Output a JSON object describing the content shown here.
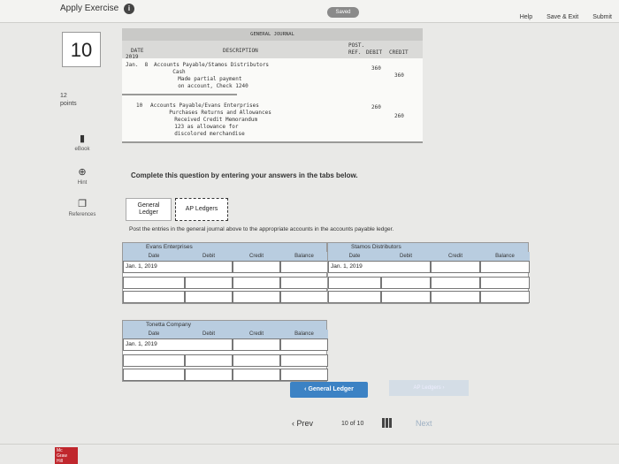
{
  "app": {
    "title": "Apply Exercise",
    "saved": "Saved",
    "help": "Help",
    "save_exit": "Save & Exit",
    "submit": "Submit"
  },
  "question": {
    "number": "10",
    "points_value": "12",
    "points_label": "points"
  },
  "side_tools": [
    {
      "label": "eBook",
      "icon": "book-icon"
    },
    {
      "label": "Hint",
      "icon": "hint-icon"
    },
    {
      "label": "References",
      "icon": "references-icon"
    }
  ],
  "journal": {
    "title": "GENERAL JOURNAL",
    "col_date": "DATE",
    "col_desc": "DESCRIPTION",
    "col_post": "POST.",
    "col_ref": "REF.",
    "col_debit": "DEBIT",
    "col_credit": "CREDIT",
    "year": "2019",
    "lines": [
      {
        "date": "Jan.  8",
        "text": "Accounts Payable/Stamos Distributors",
        "debit": "360",
        "credit": ""
      },
      {
        "date": "",
        "text": "  Cash",
        "debit": "",
        "credit": "360"
      },
      {
        "date": "",
        "text": "  Made partial payment",
        "debit": "",
        "credit": ""
      },
      {
        "date": "",
        "text": "  on account, Check 1240",
        "debit": "",
        "credit": ""
      },
      {
        "date": "10",
        "text": "Accounts Payable/Evans Enterprises",
        "debit": "260",
        "credit": ""
      },
      {
        "date": "",
        "text": "  Purchases Returns and Allowances",
        "debit": "",
        "credit": "260"
      },
      {
        "date": "",
        "text": "  Received Credit Memorandum",
        "debit": "",
        "credit": ""
      },
      {
        "date": "",
        "text": "  123 as allowance for",
        "debit": "",
        "credit": ""
      },
      {
        "date": "",
        "text": "  discolored merchandise",
        "debit": "",
        "credit": ""
      }
    ]
  },
  "instruction": "Complete this question by entering your answers in the tabs below.",
  "tabs": [
    {
      "label_line1": "General",
      "label_line2": "Ledger"
    },
    {
      "label_line1": "AP Ledgers",
      "label_line2": ""
    }
  ],
  "post_instruction": "Post the entries in the general journal above to the appropriate accounts in the accounts payable ledger.",
  "ledgers": [
    {
      "name": "Evans Enterprises",
      "cols": [
        "Date",
        "Debit",
        "Credit",
        "Balance"
      ],
      "first_date": "Jan. 1, 2019"
    },
    {
      "name": "Stamos Distributors",
      "cols": [
        "Date",
        "Debit",
        "Credit",
        "Balance"
      ],
      "first_date": "Jan. 1, 2019"
    },
    {
      "name": "Tonetta Company",
      "cols": [
        "Date",
        "Debit",
        "Credit",
        "Balance"
      ],
      "first_date": "Jan. 1, 2019"
    }
  ],
  "buttons": {
    "general_ledger": "‹  General Ledger",
    "ap_ledgers": "AP Ledgers  ›"
  },
  "pager": {
    "prev": "‹  Prev",
    "current": "10",
    "of": "of",
    "total": "10",
    "next": "Next"
  },
  "logo": {
    "line1": "Mc",
    "line2": "Graw",
    "line3": "Hill"
  }
}
